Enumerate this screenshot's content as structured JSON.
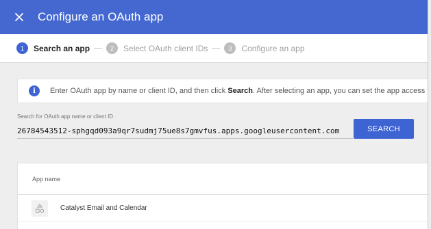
{
  "header": {
    "title": "Configure an OAuth app",
    "close_icon": "close-icon"
  },
  "stepper": {
    "steps": [
      {
        "number": "1",
        "label": "Search an app",
        "state": "active"
      },
      {
        "number": "2",
        "label": "Select OAuth client IDs",
        "state": "inactive"
      },
      {
        "number": "3",
        "label": "Configure an app",
        "state": "inactive"
      }
    ]
  },
  "info": {
    "icon": "info-icon",
    "text_before": "Enter OAuth app by name or client ID, and then click ",
    "text_bold": "Search",
    "text_after": ". After selecting an app, you can set the app access t"
  },
  "search": {
    "label": "Search for OAuth app name or client ID",
    "value": "26784543512-sphgqd093a9qr7sudmj75ue8s7gmvfus.apps.googleusercontent.com",
    "button_label": "SEARCH"
  },
  "table": {
    "columns": [
      "App name"
    ],
    "rows": [
      {
        "icon": "app-shapes-icon",
        "name": "Catalyst Email and Calendar"
      }
    ]
  },
  "colors": {
    "header_bg": "#4468d0",
    "accent": "#3e64d3",
    "inactive_step": "#bdbdbd"
  }
}
